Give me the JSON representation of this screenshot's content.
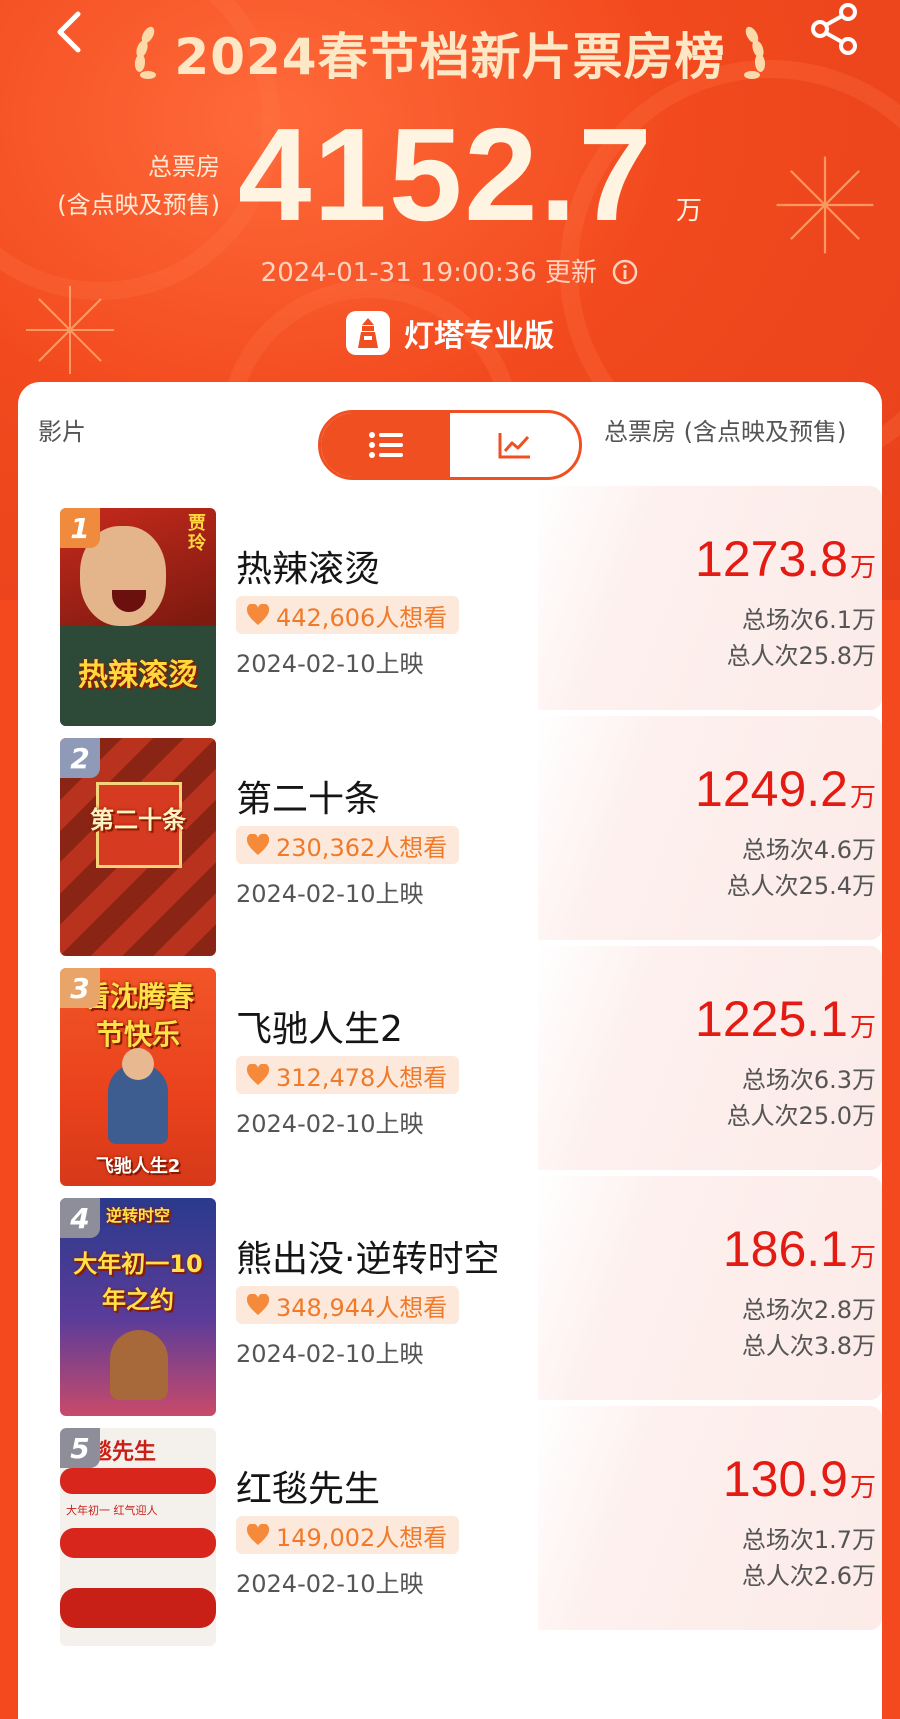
{
  "header": {
    "title": "2024春节档新片票房榜",
    "total_label_line1": "总票房",
    "total_label_line2": "(含点映及预售)",
    "total_value": "4152.7",
    "total_unit": "万",
    "update_text": "2024-01-31 19:00:36 更新",
    "brand": "灯塔专业版",
    "icons": [
      "back-arrow-icon",
      "share-icon",
      "info-icon",
      "lighthouse-logo-icon"
    ]
  },
  "list_header": {
    "film_label": "影片",
    "total_label": "总票房 (含点映及预售)",
    "toggle": [
      {
        "name": "list-view",
        "icon": "list-icon",
        "active": true
      },
      {
        "name": "chart-view",
        "icon": "trend-chart-icon",
        "active": false
      }
    ]
  },
  "colors": {
    "brand_red": "#f04f22",
    "gross_red": "#e31b13",
    "want_orange": "#f07a2a",
    "rank_gold": "#f08a3c",
    "rank_silver": "#8f9ab8",
    "rank_bronze": "#e9a46a",
    "rank_gray": "#8e8e9a"
  },
  "movies": [
    {
      "rank": "1",
      "name": "热辣滚烫",
      "want": "442,606人想看",
      "release": "2024-02-10上映",
      "gross": "1273.8",
      "unit": "万",
      "shows": "总场次6.1万",
      "admissions": "总人次25.8万",
      "poster_text": "热辣滚烫",
      "poster_side": "贾玲"
    },
    {
      "rank": "2",
      "name": "第二十条",
      "want": "230,362人想看",
      "release": "2024-02-10上映",
      "gross": "1249.2",
      "unit": "万",
      "shows": "总场次4.6万",
      "admissions": "总人次25.4万",
      "poster_text": "第二十条"
    },
    {
      "rank": "3",
      "name": "飞驰人生2",
      "want": "312,478人想看",
      "release": "2024-02-10上映",
      "gross": "1225.1",
      "unit": "万",
      "shows": "总场次6.3万",
      "admissions": "总人次25.0万",
      "poster_text": "看沈腾春节快乐",
      "poster_sub": "飞驰人生2"
    },
    {
      "rank": "4",
      "name": "熊出没·逆转时空",
      "want": "348,944人想看",
      "release": "2024-02-10上映",
      "gross": "186.1",
      "unit": "万",
      "shows": "总场次2.8万",
      "admissions": "总人次3.8万",
      "poster_text": "大年初一10年之约",
      "poster_top": "逆转时空"
    },
    {
      "rank": "5",
      "name": "红毯先生",
      "want": "149,002人想看",
      "release": "2024-02-10上映",
      "gross": "130.9",
      "unit": "万",
      "shows": "总场次1.7万",
      "admissions": "总人次2.6万",
      "poster_text": "毯先生",
      "poster_sub": "大年初一 红气迎人"
    }
  ]
}
